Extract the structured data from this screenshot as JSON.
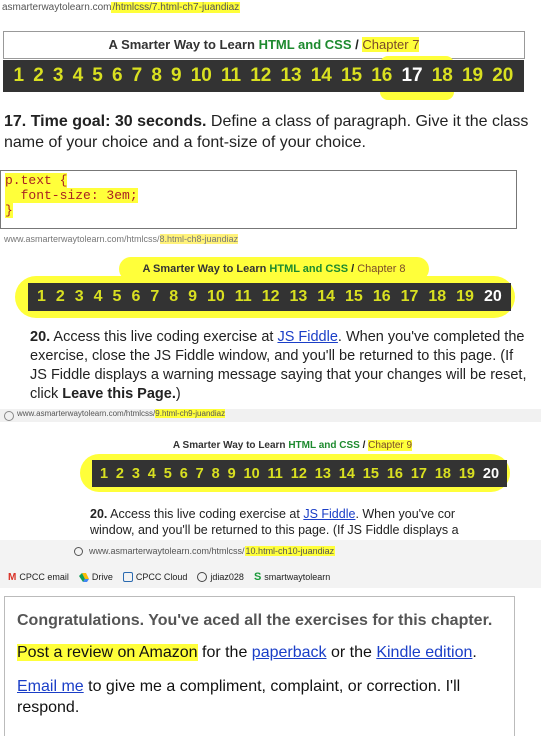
{
  "shot1": {
    "url_prefix": "asmarterwaytolearn.com",
    "url_path": "/htmlcss/7.html-ch7-juandiaz",
    "header": {
      "title": "A Smarter Way to Learn ",
      "green": "HTML and CSS",
      "sep": " / ",
      "chapter": "Chapter 7"
    },
    "nav": [
      "1",
      "2",
      "3",
      "4",
      "5",
      "6",
      "7",
      "8",
      "9",
      "10",
      "11",
      "12",
      "13",
      "14",
      "15",
      "16",
      "17",
      "18",
      "19",
      "20"
    ],
    "current": "17",
    "exercise_num": "17. Time goal: 30 seconds.",
    "exercise_text": " Define a class of paragraph. Give it the class name of your choice and a font-size of your choice.",
    "code_line1": "p.text {",
    "code_line2": "  font-size: 3em;",
    "code_line3": "}"
  },
  "shot2": {
    "url_prefix": "www.asmarterwaytolearn.com/htmlcss/",
    "url_path": "8.html-ch8-juandiaz",
    "header": {
      "title": "A Smarter Way to Learn ",
      "green": "HTML and CSS",
      "sep": " / ",
      "chapter": "Chapter 8"
    },
    "nav": [
      "1",
      "2",
      "3",
      "4",
      "5",
      "6",
      "7",
      "8",
      "9",
      "10",
      "11",
      "12",
      "13",
      "14",
      "15",
      "16",
      "17",
      "18",
      "19",
      "20"
    ],
    "current": "20",
    "exercise_num": "20.",
    "exercise_text_1": " Access this live coding exercise at ",
    "link": "JS Fiddle",
    "exercise_text_2": ". When you've completed the exercise, close the JS Fiddle window, and you'll be returned to this page. (If JS Fiddle displays a warning message saying that your changes will be reset, click ",
    "leave": "Leave this Page.",
    "exercise_text_3": ")"
  },
  "shot3": {
    "url_prefix": "www.asmarterwaytolearn.com/htmlcss/",
    "url_path": "9.html-ch9-juandiaz",
    "header": {
      "title": "A Smarter Way to Learn ",
      "green": "HTML and CSS",
      "sep": " / ",
      "chapter": "Chapter 9"
    },
    "nav": [
      "1",
      "2",
      "3",
      "4",
      "5",
      "6",
      "7",
      "8",
      "9",
      "10",
      "11",
      "12",
      "13",
      "14",
      "15",
      "16",
      "17",
      "18",
      "19",
      "20"
    ],
    "current": "20",
    "exercise_num": "20.",
    "exercise_text_1": " Access this live coding exercise at ",
    "link": "JS Fiddle",
    "exercise_text_2": ". When you've cor",
    "exercise_line2": "window, and you'll be returned to this page. (If JS Fiddle displays a"
  },
  "shot4": {
    "url_prefix": "www.asmarterwaytolearn.com/htmlcss/",
    "url_path": "10.html-ch10-juandiaz",
    "bookmarks": [
      {
        "icon": "gmail-icon",
        "label": "CPCC email"
      },
      {
        "icon": "drive-icon",
        "label": "Drive"
      },
      {
        "icon": "cloud-icon",
        "label": "CPCC Cloud"
      },
      {
        "icon": "globe-icon",
        "label": "jdiaz028"
      },
      {
        "icon": "s-icon",
        "label": "smartwaytolearn"
      }
    ],
    "congrats": "Congratulations. You've aced all the exercises for this chapter.",
    "review_1": "Post a review on Amazon",
    "review_2": " for the ",
    "paperback": "paperback",
    "review_3": " or the ",
    "kindle": "Kindle edition",
    "review_4": ".",
    "email": "Email me",
    "email_text": " to give me a compliment, complaint, or correction. I'll respond."
  },
  "colors": {
    "highlight": "#ffff3a",
    "nav_bg": "#333333",
    "nav_fg": "#d9e021",
    "green": "#1d8a2e",
    "link": "#1a3ec7"
  }
}
